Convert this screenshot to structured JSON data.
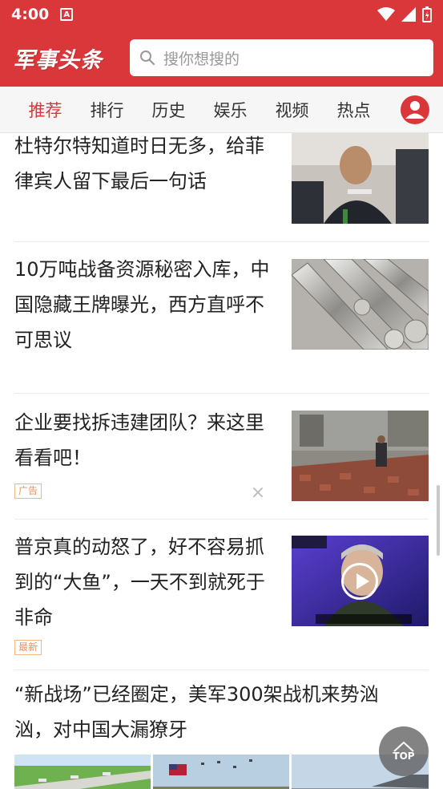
{
  "status": {
    "time": "4:00",
    "notif_icon": "A"
  },
  "header": {
    "logo": "军事头条",
    "search_placeholder": "搜你想搜的"
  },
  "tabs": [
    "推荐",
    "排行",
    "历史",
    "娱乐",
    "视频",
    "热点"
  ],
  "feed": {
    "item1": {
      "title": "杜特尔特知道时日无多，给菲律宾人留下最后一句话"
    },
    "item2": {
      "title": "10万吨战备资源秘密入库，中国隐藏王牌曝光，西方直呼不可思议"
    },
    "item3": {
      "title": "企业要找拆违建团队？来这里看看吧！",
      "tag": "广告"
    },
    "item4": {
      "title": "普京真的动怒了，好不容易抓到的“大鱼”，一天不到就死于非命",
      "tag": "最新"
    },
    "item5": {
      "title": "“新战场”已经圈定，美军300架战机来势汹汹，对中国大漏獠牙"
    }
  },
  "top_button": {
    "label": "TOP"
  },
  "colors": {
    "brand": "#d9373a",
    "tag": "#e8945a"
  }
}
